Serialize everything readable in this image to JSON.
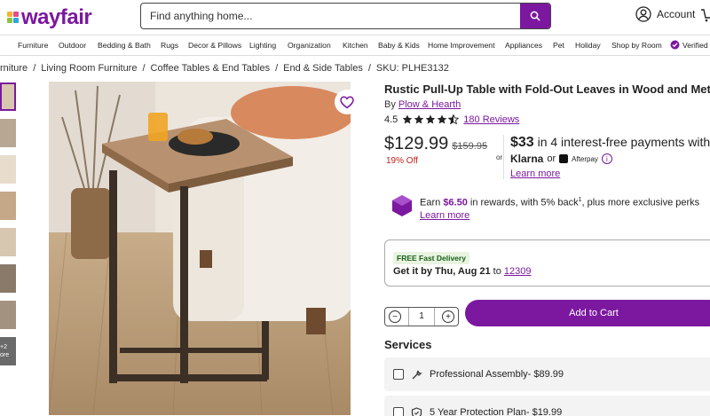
{
  "brand": {
    "name": "wayfair",
    "accent": "#7b189f"
  },
  "search": {
    "placeholder": "Find anything home..."
  },
  "account": {
    "label": "Account"
  },
  "nav": {
    "items": [
      "Furniture",
      "Outdoor",
      "Bedding & Bath",
      "Rugs",
      "Decor & Pillows",
      "Lighting",
      "Organization",
      "Kitchen",
      "Baby & Kids",
      "Home Improvement",
      "Appliances",
      "Pet",
      "Holiday",
      "Shop by Room",
      "Verified"
    ]
  },
  "breadcrumbs": {
    "items": [
      "rniture",
      "Living Room Furniture",
      "Coffee Tables & End Tables",
      "End & Side Tables",
      "SKU: PLHE3132"
    ],
    "separator": "/"
  },
  "thumbnails": {
    "more_label": "+2 ore"
  },
  "product": {
    "title": "Rustic Pull-Up Table with Fold-Out Leaves in Wood and Metal",
    "by": "By",
    "brand": "Plow & Hearth",
    "rating": "4.5",
    "reviews": "180 Reviews",
    "price": "$129.99",
    "old_price": "$159.95",
    "discount": "19% Off"
  },
  "financing": {
    "or": "or",
    "amount": "$33",
    "text": "in 4 interest-free payments with",
    "klarna": "Klarna",
    "or2": "or",
    "afterpay": "Afterpay",
    "info": "i",
    "learn_more": "Learn more"
  },
  "rewards": {
    "earn": "Earn",
    "amount": "$6.50",
    "text": "in rewards, with 5% back",
    "sup": "1",
    "text2": ", plus more exclusive perks",
    "learn_more": "Learn more"
  },
  "delivery": {
    "badge": "FREE Fast Delivery",
    "prefix": "Get it by Thu, Aug 21",
    "to": "to",
    "zip": "12309"
  },
  "cart": {
    "minus": "−",
    "qty": "1",
    "plus": "+",
    "add_label": "Add to Cart"
  },
  "services": {
    "heading": "Services",
    "items": [
      {
        "label": "Professional Assembly- $89.99"
      },
      {
        "label": "5 Year Protection Plan- $19.99"
      }
    ]
  }
}
